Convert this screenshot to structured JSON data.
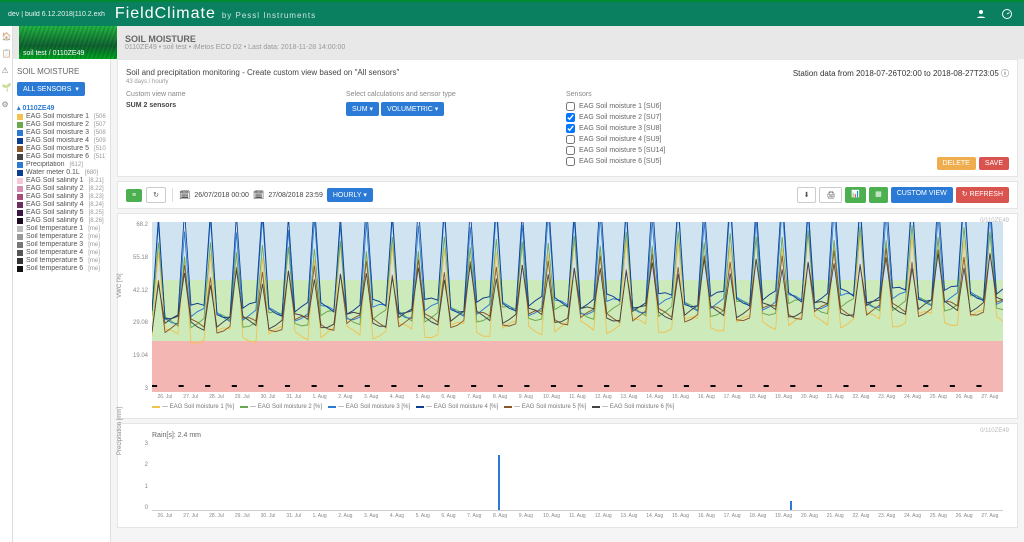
{
  "build_info": "dev | build 6.12.2018|110.2.exh",
  "brand": "FieldClimate",
  "brand_by": "by Pessl Instruments",
  "station_strip": {
    "caption": "soil test / 0110ZE49",
    "title": "SOIL MOISTURE",
    "subtitle": "0110ZE49 • soil test • iMetos ECO D2 • Last data: 2018-11-28 14:00:00"
  },
  "sidebar": {
    "heading": "SOIL MOISTURE",
    "all_sensors": "ALL SENSORS",
    "station": "0110ZE49",
    "items": [
      {
        "color": "#f2c14e",
        "label": "EAG Soil moisture 1",
        "sub": "[506]"
      },
      {
        "color": "#6aa84f",
        "label": "EAG Soil moisture 2",
        "sub": "[507]"
      },
      {
        "color": "#2b7bd6",
        "label": "EAG Soil moisture 3",
        "sub": "[508]"
      },
      {
        "color": "#0b3d91",
        "label": "EAG Soil moisture 4",
        "sub": "[509]"
      },
      {
        "color": "#8b572a",
        "label": "EAG Soil moisture 5",
        "sub": "[510]"
      },
      {
        "color": "#444444",
        "label": "EAG Soil moisture 6",
        "sub": "[511]"
      },
      {
        "color": "#2b7bd6",
        "label": "Precipitation",
        "sub": "[612]"
      },
      {
        "color": "#0b3d91",
        "label": "Water meter 0.1L",
        "sub": "[680]"
      },
      {
        "color": "#f7c6d9",
        "label": "EAG Soil salinity 1",
        "sub": "[8.21]"
      },
      {
        "color": "#d48fb3",
        "label": "EAG Soil salinity 2",
        "sub": "[8.22]"
      },
      {
        "color": "#a64d79",
        "label": "EAG Soil salinity 3",
        "sub": "[8.23]"
      },
      {
        "color": "#6b2d5c",
        "label": "EAG Soil salinity 4",
        "sub": "[8.24]"
      },
      {
        "color": "#3c1642",
        "label": "EAG Soil salinity 5",
        "sub": "[8.25]"
      },
      {
        "color": "#1b0a20",
        "label": "EAG Soil salinity 6",
        "sub": "[8.26]"
      },
      {
        "color": "#bdbdbd",
        "label": "Soil temperature 1",
        "sub": "[me]"
      },
      {
        "color": "#999999",
        "label": "Soil temperature 2",
        "sub": "[me]"
      },
      {
        "color": "#777777",
        "label": "Soil temperature 3",
        "sub": "[me]"
      },
      {
        "color": "#555555",
        "label": "Soil temperature 4",
        "sub": "[me]"
      },
      {
        "color": "#333333",
        "label": "Soil temperature 5",
        "sub": "[me]"
      },
      {
        "color": "#111111",
        "label": "Soil temperature 6",
        "sub": "[me]"
      }
    ]
  },
  "header": {
    "title": "Soil and precipitation monitoring - Create custom view based on \"All sensors\"",
    "subtitle": "43 days / hourly",
    "station_from": "Station data from",
    "date_start": "2018-07-26T02:00",
    "date_to_label": "to",
    "date_end": "2018-08-27T23:05"
  },
  "config": {
    "custom_view_label": "Custom view name",
    "custom_view_value": "SUM 2 sensors",
    "calc_label": "Select calculations and sensor type",
    "btn_sum": "SUM ▾",
    "btn_vol": "VOLUMETRIC ▾",
    "sensors_label": "Sensors",
    "sensors": [
      {
        "checked": false,
        "label": "EAG Soil moisture 1 [SU6]"
      },
      {
        "checked": true,
        "label": "EAG Soil moisture 2 [SU7]"
      },
      {
        "checked": true,
        "label": "EAG Soil moisture 3 [SU8]"
      },
      {
        "checked": false,
        "label": "EAG Soil moisture 4 [SU9]"
      },
      {
        "checked": false,
        "label": "EAG Soil moisture 5 [SU14]"
      },
      {
        "checked": false,
        "label": "EAG Soil moisture 6 [SU5]"
      }
    ],
    "delete_btn": "DELETE",
    "save_btn": "SAVE"
  },
  "toolbar": {
    "date_from": "26/07/2018 00:00",
    "date_to": "27/08/2018 23:59",
    "mode": "HOURLY ▾",
    "custom_view": "CUSTOM VIEW",
    "refresh": "REFRESH"
  },
  "chart_data": [
    {
      "type": "line",
      "cid": "0/110ZE49",
      "ylabel": "VWC [%]",
      "ylim": [
        3,
        68.2
      ],
      "yticks": [
        68.2,
        55.18,
        42.12,
        29.08,
        19.04,
        3
      ],
      "zones": {
        "blue": [
          42.12,
          68.2
        ],
        "green": [
          19.04,
          42.12
        ],
        "red": [
          3,
          19.04
        ]
      },
      "categories": [
        "26. Jul",
        "27. Jul",
        "28. Jul",
        "29. Jul",
        "30. Jul",
        "31. Jul",
        "1. Aug",
        "2. Aug",
        "3. Aug",
        "4. Aug",
        "5. Aug",
        "6. Aug",
        "7. Aug",
        "8. Aug",
        "9. Aug",
        "10. Aug",
        "11. Aug",
        "12. Aug",
        "13. Aug",
        "14. Aug",
        "15. Aug",
        "16. Aug",
        "17. Aug",
        "18. Aug",
        "19. Aug",
        "20. Aug",
        "21. Aug",
        "22. Aug",
        "23. Aug",
        "24. Aug",
        "25. Aug",
        "26. Aug",
        "27. Aug"
      ],
      "series": [
        {
          "name": "EAG Soil moisture 1 [%]",
          "color": "#f2c14e"
        },
        {
          "name": "EAG Soil moisture 2 [%]",
          "color": "#6aa84f"
        },
        {
          "name": "EAG Soil moisture 3 [%]",
          "color": "#2b7bd6"
        },
        {
          "name": "EAG Soil moisture 4 [%]",
          "color": "#0b3d91"
        },
        {
          "name": "EAG Soil moisture 5 [%]",
          "color": "#8b572a"
        },
        {
          "name": "EAG Soil moisture 6 [%]",
          "color": "#444444"
        }
      ]
    },
    {
      "type": "bar",
      "cid": "0/110ZE49",
      "title": "Rain[s]: 2.4 mm",
      "ylabel": "Precipitation [mm]",
      "ylim": [
        0,
        3
      ],
      "categories": [
        "26. Jul",
        "27. Jul",
        "28. Jul",
        "29. Jul",
        "30. Jul",
        "31. Jul",
        "1. Aug",
        "2. Aug",
        "3. Aug",
        "4. Aug",
        "5. Aug",
        "6. Aug",
        "7. Aug",
        "8. Aug",
        "9. Aug",
        "10. Aug",
        "11. Aug",
        "12. Aug",
        "13. Aug",
        "14. Aug",
        "15. Aug",
        "16. Aug",
        "17. Aug",
        "18. Aug",
        "19. Aug",
        "20. Aug",
        "21. Aug",
        "22. Aug",
        "23. Aug",
        "24. Aug",
        "25. Aug",
        "26. Aug",
        "27. Aug"
      ],
      "values": [
        0,
        0,
        0,
        0,
        0,
        0,
        0,
        0,
        0,
        0,
        0,
        0,
        0,
        2.4,
        0,
        0,
        0,
        0,
        0,
        0,
        0,
        0,
        0,
        0,
        0.4,
        0,
        0,
        0,
        0,
        0,
        0,
        0,
        0
      ]
    }
  ]
}
